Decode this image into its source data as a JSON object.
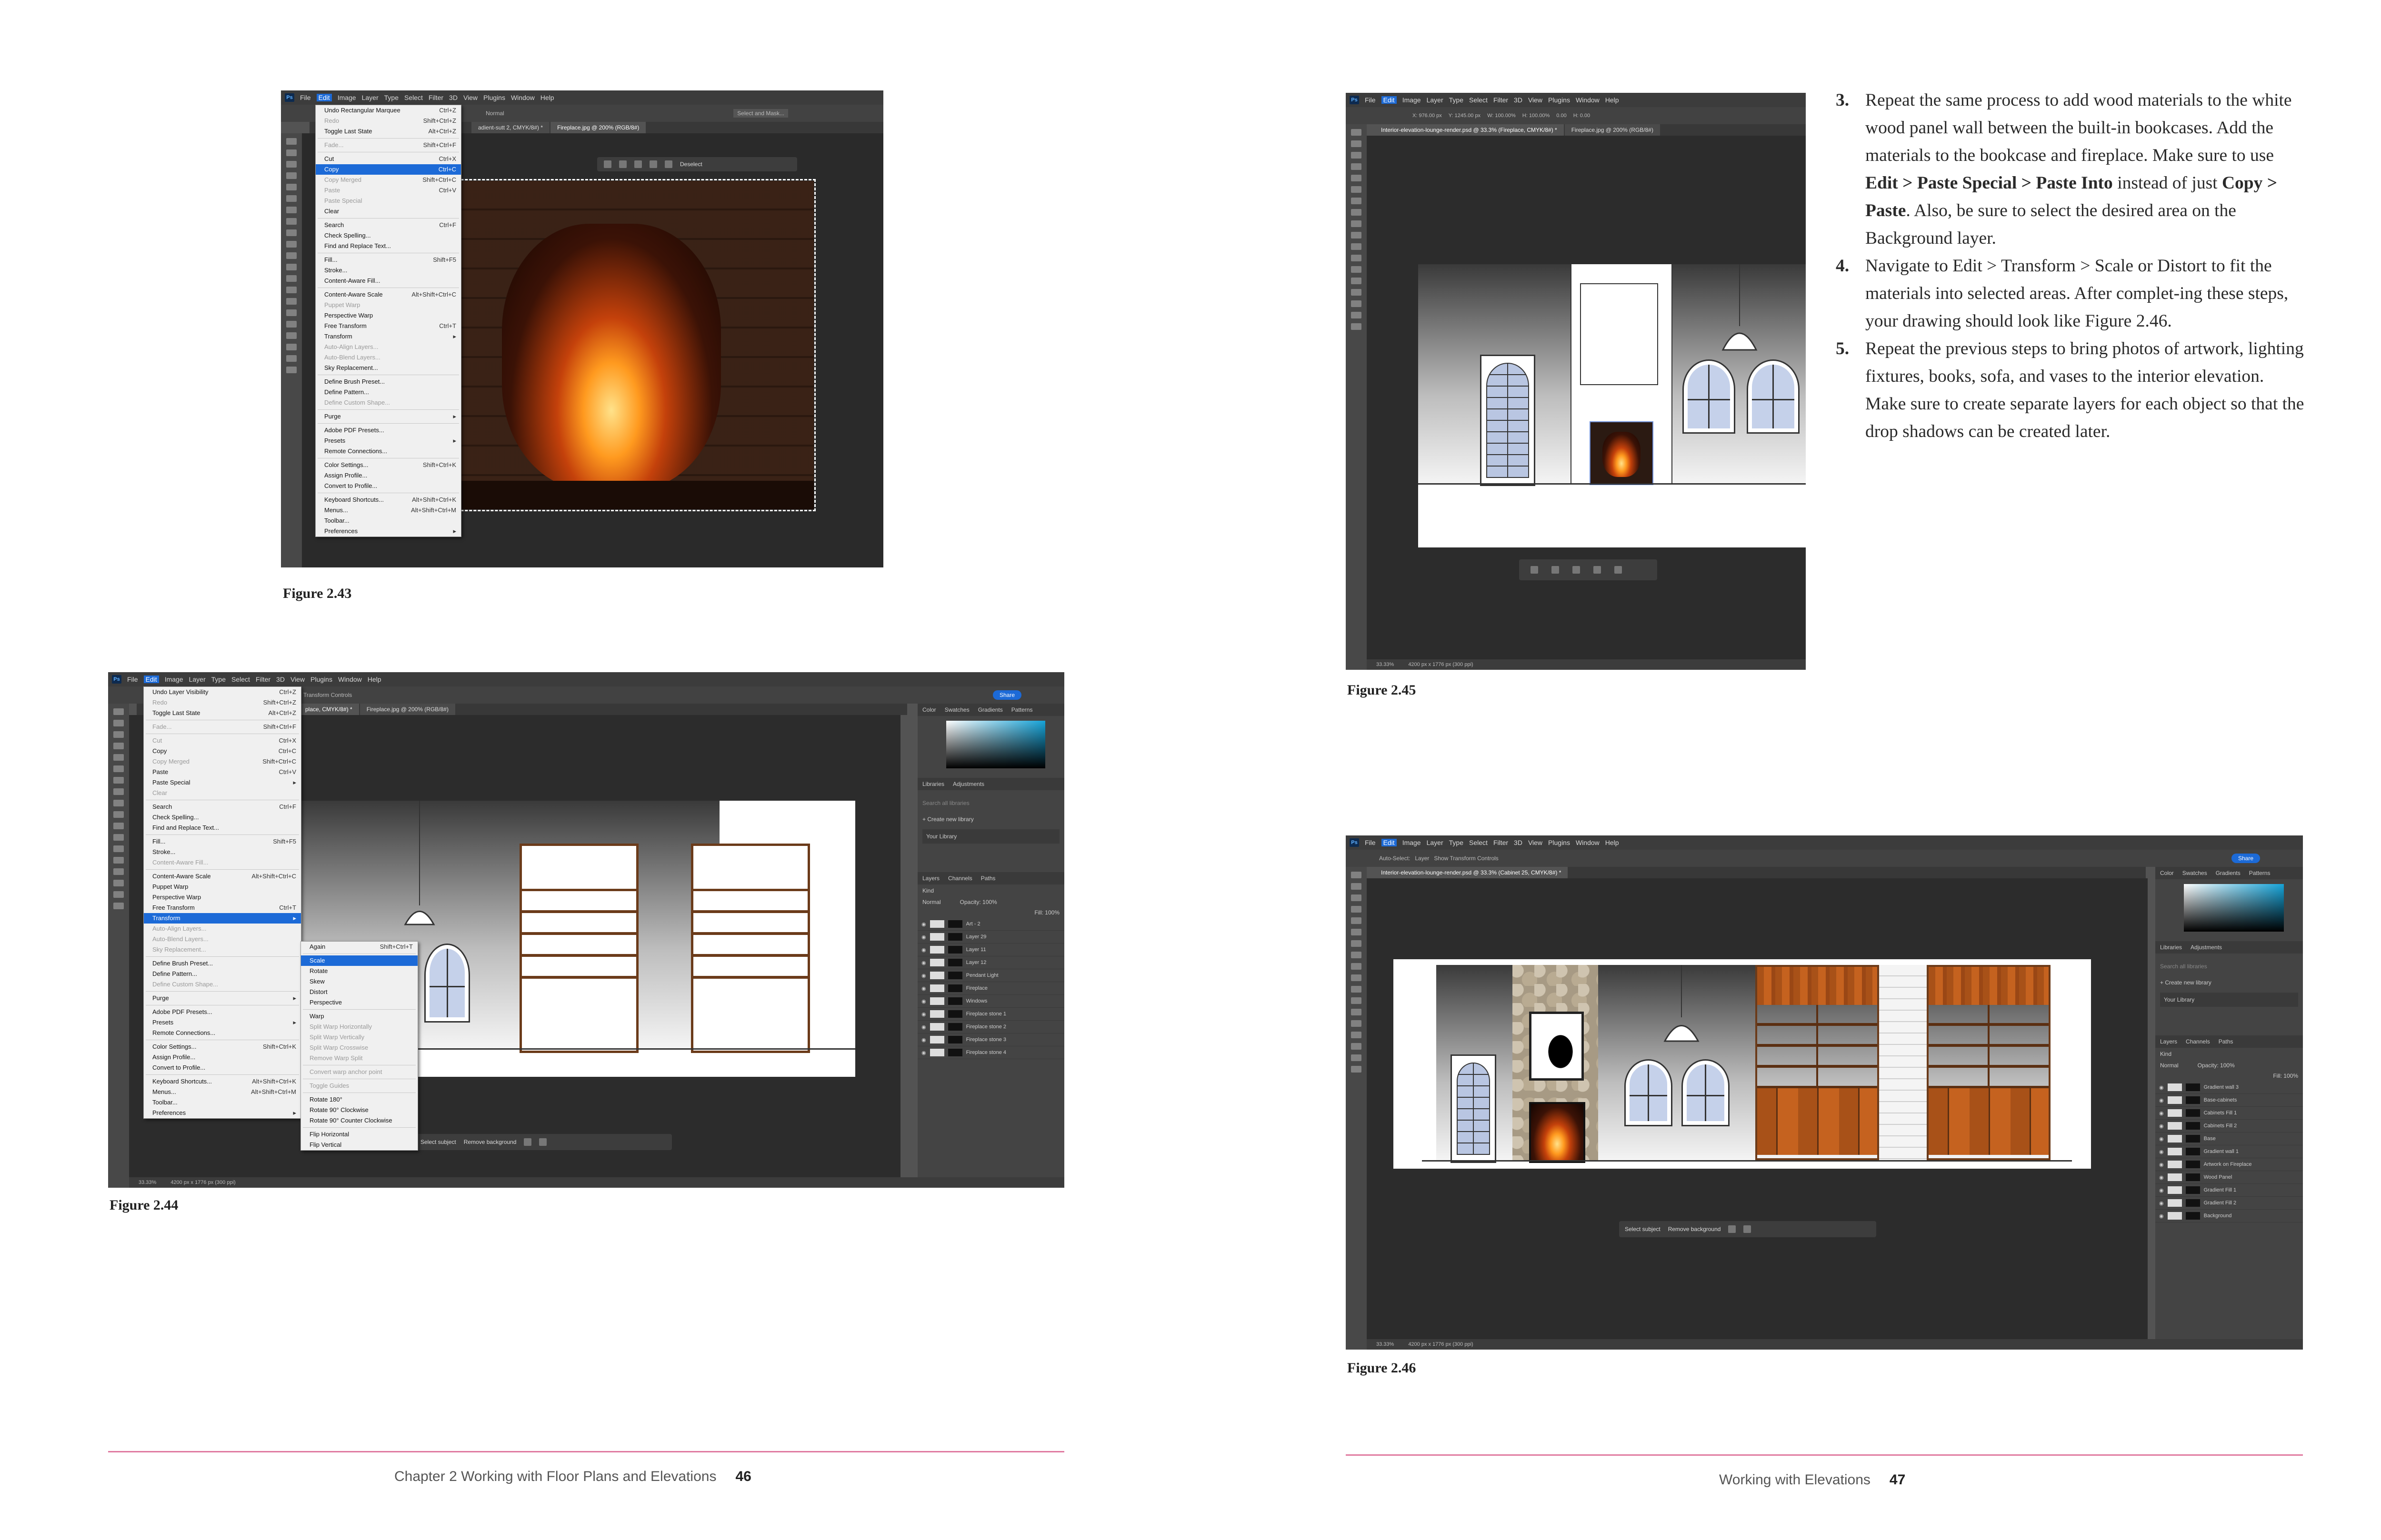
{
  "colors": {
    "accent_rule": "#e07aa0",
    "ps_dark": "#535353",
    "highlight": "#1c6ad7"
  },
  "fig43": {
    "caption": "Figure 2.43",
    "menubar": [
      "File",
      "Edit",
      "Image",
      "Layer",
      "Type",
      "Select",
      "Filter",
      "3D",
      "View",
      "Plugins",
      "Window",
      "Help"
    ],
    "tab": "Fireplace.jpg @ 200% (RGB/8#)",
    "tab_partial": "adient-sutt 2, CMYK/8#) *",
    "opt_right": "Select and Mask...",
    "opt_normal": "Normal",
    "context_label": "Deselect",
    "menu": [
      {
        "label": "Undo Rectangular Marquee",
        "sc": "Ctrl+Z"
      },
      {
        "label": "Redo",
        "sc": "Shift+Ctrl+Z",
        "dis": true
      },
      {
        "label": "Toggle Last State",
        "sc": "Alt+Ctrl+Z"
      },
      {
        "sep": true
      },
      {
        "label": "Fade...",
        "sc": "Shift+Ctrl+F",
        "dis": true
      },
      {
        "sep": true
      },
      {
        "label": "Cut",
        "sc": "Ctrl+X"
      },
      {
        "label": "Copy",
        "sc": "Ctrl+C",
        "hl": true
      },
      {
        "label": "Copy Merged",
        "sc": "Shift+Ctrl+C",
        "dis": true
      },
      {
        "label": "Paste",
        "sc": "Ctrl+V",
        "dis": true
      },
      {
        "label": "Paste Special",
        "sc": "",
        "dis": true
      },
      {
        "label": "Clear",
        "sc": ""
      },
      {
        "sep": true
      },
      {
        "label": "Search",
        "sc": "Ctrl+F"
      },
      {
        "label": "Check Spelling...",
        "sc": ""
      },
      {
        "label": "Find and Replace Text...",
        "sc": ""
      },
      {
        "sep": true
      },
      {
        "label": "Fill...",
        "sc": "Shift+F5"
      },
      {
        "label": "Stroke...",
        "sc": ""
      },
      {
        "label": "Content-Aware Fill...",
        "sc": ""
      },
      {
        "sep": true
      },
      {
        "label": "Content-Aware Scale",
        "sc": "Alt+Shift+Ctrl+C"
      },
      {
        "label": "Puppet Warp",
        "sc": "",
        "dis": true
      },
      {
        "label": "Perspective Warp",
        "sc": ""
      },
      {
        "label": "Free Transform",
        "sc": "Ctrl+T"
      },
      {
        "label": "Transform",
        "sc": "▸"
      },
      {
        "label": "Auto-Align Layers...",
        "sc": "",
        "dis": true
      },
      {
        "label": "Auto-Blend Layers...",
        "sc": "",
        "dis": true
      },
      {
        "label": "Sky Replacement...",
        "sc": ""
      },
      {
        "sep": true
      },
      {
        "label": "Define Brush Preset...",
        "sc": ""
      },
      {
        "label": "Define Pattern...",
        "sc": ""
      },
      {
        "label": "Define Custom Shape...",
        "sc": "",
        "dis": true
      },
      {
        "sep": true
      },
      {
        "label": "Purge",
        "sc": "▸"
      },
      {
        "sep": true
      },
      {
        "label": "Adobe PDF Presets...",
        "sc": ""
      },
      {
        "label": "Presets",
        "sc": "▸"
      },
      {
        "label": "Remote Connections...",
        "sc": ""
      },
      {
        "sep": true
      },
      {
        "label": "Color Settings...",
        "sc": "Shift+Ctrl+K"
      },
      {
        "label": "Assign Profile...",
        "sc": ""
      },
      {
        "label": "Convert to Profile...",
        "sc": ""
      },
      {
        "sep": true
      },
      {
        "label": "Keyboard Shortcuts...",
        "sc": "Alt+Shift+Ctrl+K"
      },
      {
        "label": "Menus...",
        "sc": "Alt+Shift+Ctrl+M"
      },
      {
        "label": "Toolbar...",
        "sc": ""
      },
      {
        "label": "Preferences",
        "sc": "▸"
      }
    ]
  },
  "fig44": {
    "caption": "Figure 2.44",
    "tabs": [
      "place, CMYK/8#) *",
      "Fireplace.jpg @ 200% (RGB/8#)"
    ],
    "opt": "Transform Controls",
    "share": "Share",
    "panel_tabs": [
      "Color",
      "Swatches",
      "Gradients",
      "Patterns"
    ],
    "lib_tabs": [
      "Libraries",
      "Adjustments"
    ],
    "lib_search": "Search all libraries",
    "lib_create": "+ Create new library",
    "lib_item": "Your Library",
    "layer_tabs": [
      "Layers",
      "Channels",
      "Paths"
    ],
    "layer_kind": "Kind",
    "layer_mode": "Normal",
    "opacity": "Opacity: 100%",
    "fill": "Fill: 100%",
    "layers": [
      "Art - 2",
      "Layer 29",
      "Layer 11",
      "Layer 12",
      "Pendant Light",
      "Fireplace",
      "Windows",
      "Fireplace stone 1",
      "Fireplace stone 2",
      "Fireplace stone 3",
      "Fireplace stone 4"
    ],
    "status": [
      "33.33%",
      "4200 px x 1776 px (300 ppi)"
    ],
    "ctx": [
      "Select subject",
      "Remove background"
    ],
    "menu": [
      {
        "label": "Undo Layer Visibility",
        "sc": "Ctrl+Z"
      },
      {
        "label": "Redo",
        "sc": "Shift+Ctrl+Z",
        "dis": true
      },
      {
        "label": "Toggle Last State",
        "sc": "Alt+Ctrl+Z"
      },
      {
        "sep": true
      },
      {
        "label": "Fade...",
        "sc": "Shift+Ctrl+F",
        "dis": true
      },
      {
        "sep": true
      },
      {
        "label": "Cut",
        "sc": "Ctrl+X",
        "dis": true
      },
      {
        "label": "Copy",
        "sc": "Ctrl+C"
      },
      {
        "label": "Copy Merged",
        "sc": "Shift+Ctrl+C",
        "dis": true
      },
      {
        "label": "Paste",
        "sc": "Ctrl+V"
      },
      {
        "label": "Paste Special",
        "sc": "▸"
      },
      {
        "label": "Clear",
        "sc": "",
        "dis": true
      },
      {
        "sep": true
      },
      {
        "label": "Search",
        "sc": "Ctrl+F"
      },
      {
        "label": "Check Spelling...",
        "sc": ""
      },
      {
        "label": "Find and Replace Text...",
        "sc": ""
      },
      {
        "sep": true
      },
      {
        "label": "Fill...",
        "sc": "Shift+F5"
      },
      {
        "label": "Stroke...",
        "sc": ""
      },
      {
        "label": "Content-Aware Fill...",
        "sc": "",
        "dis": true
      },
      {
        "sep": true
      },
      {
        "label": "Content-Aware Scale",
        "sc": "Alt+Shift+Ctrl+C"
      },
      {
        "label": "Puppet Warp",
        "sc": ""
      },
      {
        "label": "Perspective Warp",
        "sc": ""
      },
      {
        "label": "Free Transform",
        "sc": "Ctrl+T"
      },
      {
        "label": "Transform",
        "sc": "▸",
        "hl": true
      },
      {
        "label": "Auto-Align Layers...",
        "sc": "",
        "dis": true
      },
      {
        "label": "Auto-Blend Layers...",
        "sc": "",
        "dis": true
      },
      {
        "label": "Sky Replacement...",
        "sc": "",
        "dis": true
      },
      {
        "sep": true
      },
      {
        "label": "Define Brush Preset...",
        "sc": ""
      },
      {
        "label": "Define Pattern...",
        "sc": ""
      },
      {
        "label": "Define Custom Shape...",
        "sc": "",
        "dis": true
      },
      {
        "sep": true
      },
      {
        "label": "Purge",
        "sc": "▸"
      },
      {
        "sep": true
      },
      {
        "label": "Adobe PDF Presets...",
        "sc": ""
      },
      {
        "label": "Presets",
        "sc": "▸"
      },
      {
        "label": "Remote Connections...",
        "sc": ""
      },
      {
        "sep": true
      },
      {
        "label": "Color Settings...",
        "sc": "Shift+Ctrl+K"
      },
      {
        "label": "Assign Profile...",
        "sc": ""
      },
      {
        "label": "Convert to Profile...",
        "sc": ""
      },
      {
        "sep": true
      },
      {
        "label": "Keyboard Shortcuts...",
        "sc": "Alt+Shift+Ctrl+K"
      },
      {
        "label": "Menus...",
        "sc": "Alt+Shift+Ctrl+M"
      },
      {
        "label": "Toolbar...",
        "sc": ""
      },
      {
        "label": "Preferences",
        "sc": "▸"
      }
    ],
    "submenu": [
      {
        "label": "Again",
        "sc": "Shift+Ctrl+T"
      },
      {
        "sep": true
      },
      {
        "label": "Scale",
        "sc": "",
        "hl": true
      },
      {
        "label": "Rotate",
        "sc": ""
      },
      {
        "label": "Skew",
        "sc": ""
      },
      {
        "label": "Distort",
        "sc": ""
      },
      {
        "label": "Perspective",
        "sc": ""
      },
      {
        "sep": true
      },
      {
        "label": "Warp",
        "sc": ""
      },
      {
        "label": "Split Warp Horizontally",
        "sc": "",
        "dis": true
      },
      {
        "label": "Split Warp Vertically",
        "sc": "",
        "dis": true
      },
      {
        "label": "Split Warp Crosswise",
        "sc": "",
        "dis": true
      },
      {
        "label": "Remove Warp Split",
        "sc": "",
        "dis": true
      },
      {
        "sep": true
      },
      {
        "label": "Convert warp anchor point",
        "sc": "",
        "dis": true
      },
      {
        "sep": true
      },
      {
        "label": "Toggle Guides",
        "sc": "",
        "dis": true
      },
      {
        "sep": true
      },
      {
        "label": "Rotate 180°",
        "sc": ""
      },
      {
        "label": "Rotate 90° Clockwise",
        "sc": ""
      },
      {
        "label": "Rotate 90° Counter Clockwise",
        "sc": ""
      },
      {
        "sep": true
      },
      {
        "label": "Flip Horizontal",
        "sc": ""
      },
      {
        "label": "Flip Vertical",
        "sc": ""
      }
    ]
  },
  "fig45": {
    "caption": "Figure 2.45",
    "tabs": [
      "Interior-elevation-lounge-render.psd @ 33.3% (Fireplace, CMYK/8#) *",
      "Fireplace.jpg @ 200% (RGB/8#)"
    ],
    "opt": [
      "X: 976.00 px",
      "Y: 1245.00 px",
      "W: 100.00%",
      "H: 100.00%",
      "0.00",
      "H: 0.00"
    ],
    "status": [
      "33.33%",
      "4200 px x 1776 px (300 ppi)"
    ]
  },
  "fig46": {
    "caption": "Figure 2.46",
    "tab": "Interior-elevation-lounge-render.psd @ 33.3% (Cabinet 25, CMYK/8#) *",
    "opt": [
      "Auto-Select:",
      "Layer",
      "Show Transform Controls"
    ],
    "share": "Share",
    "panel_tabs": [
      "Color",
      "Swatches",
      "Gradients",
      "Patterns"
    ],
    "lib_tabs": [
      "Libraries",
      "Adjustments"
    ],
    "lib_search": "Search all libraries",
    "lib_create": "+ Create new library",
    "lib_item": "Your Library",
    "layer_tabs": [
      "Layers",
      "Channels",
      "Paths"
    ],
    "layer_kind": "Kind",
    "layer_mode": "Normal",
    "opacity": "Opacity: 100%",
    "fill": "Fill: 100%",
    "layers": [
      "Gradient wall 3",
      "Base-cabinets",
      "Cabinets Fill 1",
      "Cabinets Fill 2",
      "Base",
      "Gradient wall 1",
      "Artwork on Fireplace",
      "Wood Panel",
      "Gradient Fill 1",
      "Gradient Fill 2",
      "Background"
    ],
    "status": [
      "33.33%",
      "4200 px x 1776 px (300 ppi)"
    ],
    "ctx": [
      "Select subject",
      "Remove background"
    ]
  },
  "steps": [
    {
      "num": "3.",
      "parts": [
        {
          "t": "Repeat the same process to add wood materials to the white wood panel wall between the built-in bookcases. Add the materials to the bookcase and fireplace. Make sure to use "
        },
        {
          "t": "Edit > Paste Special > Paste Into",
          "b": true
        },
        {
          "t": " instead of just "
        },
        {
          "t": "Copy > Paste",
          "b": true
        },
        {
          "t": ". Also, be sure to select the desired area on the Background layer."
        }
      ]
    },
    {
      "num": "4.",
      "parts": [
        {
          "t": "Navigate to Edit > Transform > Scale or Distort to fit the materials into selected areas. After complet-ing these steps, your drawing should look like Figure 2.46."
        }
      ]
    },
    {
      "num": "5.",
      "parts": [
        {
          "t": "Repeat the previous steps to bring photos of artwork, lighting fixtures, books, sofa, and vases to the interior elevation. Make sure to create separate layers for each object so that the drop shadows can be created later."
        }
      ]
    }
  ],
  "footer_left": {
    "text": "Chapter 2  Working with Floor Plans and Elevations",
    "page": "46"
  },
  "footer_right": {
    "text": "Working with Elevations",
    "page": "47"
  }
}
